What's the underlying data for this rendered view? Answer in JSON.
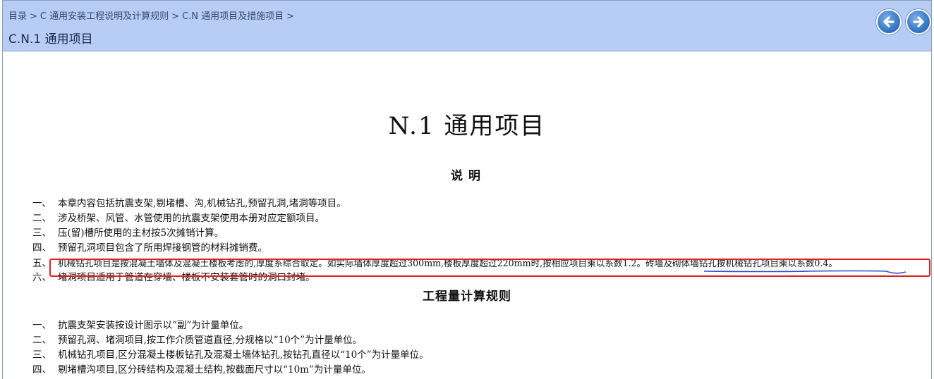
{
  "breadcrumb": {
    "items": [
      "目录",
      "C 通用安装工程说明及计算规则",
      "C.N 通用项目及措施项目"
    ],
    "separator": ">"
  },
  "header": {
    "title": "C.N.1 通用项目"
  },
  "nav": {
    "back_icon": "arrow-left-circle",
    "forward_icon": "arrow-right-circle"
  },
  "document": {
    "title": "N.1 通用项目",
    "notes_heading": "说明",
    "notes": [
      {
        "num": "一、",
        "text": "本章内容包括抗震支架,剔堵槽、沟,机械钻孔,预留孔洞,堵洞等项目。"
      },
      {
        "num": "二、",
        "text": "涉及桥架、风管、水管使用的抗震支架使用本册对应定额项目。"
      },
      {
        "num": "三、",
        "text": "压(留)槽所使用的主材按5次摊销计算。"
      },
      {
        "num": "四、",
        "text": "预留孔洞项目包含了所用焊接钢管的材料摊销费。"
      },
      {
        "num": "五、",
        "text": "机械钻孔项目是按混凝土墙体及混凝土楼板考虑的,厚度系综合取定。如实际墙体厚度超过300mm,楼板厚度超过220mm时,按相应项目乘以系数1.2。砖墙及砌体墙钻孔按机械钻孔项目乘以系数0.4。"
      },
      {
        "num": "六、",
        "text": "堵洞项目适用于管道在穿墙、楼板不安装套管时的洞口封堵。"
      }
    ],
    "rules_heading": "工程量计算规则",
    "rules": [
      {
        "num": "一、",
        "text": "抗震支架安装按设计图示以“副”为计量单位。"
      },
      {
        "num": "二、",
        "text": "预留孔洞、堵洞项目,按工作介质管道直径,分规格以“10个”为计量单位。"
      },
      {
        "num": "三、",
        "text": "机械钻孔项目,区分混凝土楼板钻孔及混凝土墙体钻孔,按钻孔直径以“10个”为计量单位。"
      },
      {
        "num": "四、",
        "text": "剔堵槽沟项目,区分砖结构及混凝土结构,按截面尺寸以“10m”为计量单位。"
      }
    ]
  },
  "colors": {
    "header_bg": "#b7cdf6",
    "annotation": "#e02020",
    "underline": "#3050c0"
  }
}
